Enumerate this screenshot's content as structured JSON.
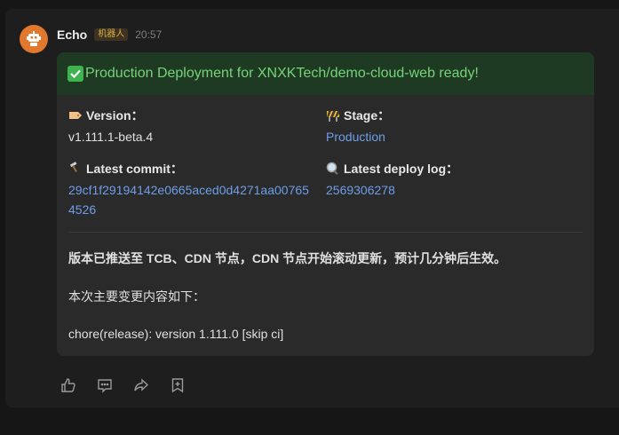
{
  "message": {
    "sender": "Echo",
    "badge": "机器人",
    "time": "20:57"
  },
  "card": {
    "title": "Production Deployment for XNXKTech/demo-cloud-web ready!",
    "fields": {
      "version_label": "Version：",
      "version_value": "v1.111.1-beta.4",
      "stage_label": "Stage：",
      "stage_value": "Production",
      "commit_label": "Latest commit：",
      "commit_value": "29cf1f29194142e0665aced0d4271aa007654526",
      "deploylog_label": "Latest deploy log：",
      "deploylog_value": "2569306278"
    },
    "body": {
      "line1": "版本已推送至 TCB、CDN 节点，CDN 节点开始滚动更新，预计几分钟后生效。",
      "line2": "本次主要变更内容如下：",
      "line3": "chore(release): version 1.111.0 [skip ci]"
    }
  },
  "icons": {
    "avatar": "robot-icon",
    "version": "label-tag-icon",
    "stage": "construction-icon",
    "commit": "hammer-icon",
    "deploylog": "magnifier-icon"
  },
  "colors": {
    "accent_link": "#6e9eea",
    "header_bg": "#1f3a23",
    "header_text": "#76d378",
    "avatar_bg": "#e0782e",
    "badge_text": "#d9ad4a"
  }
}
